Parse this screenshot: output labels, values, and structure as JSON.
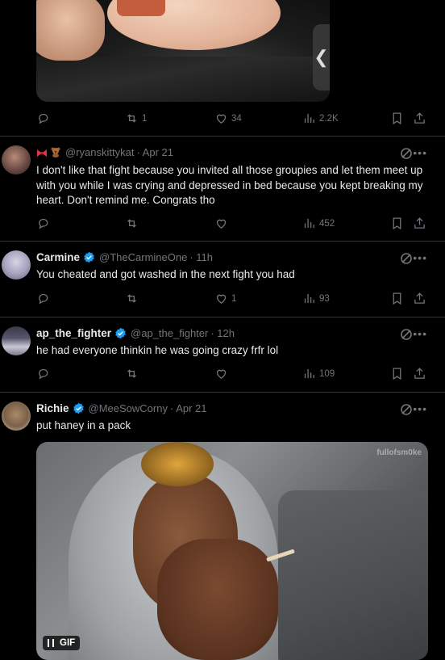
{
  "tweets": [
    {
      "id": "top",
      "actions": {
        "reply": "",
        "retweet": "1",
        "like": "34",
        "views": "2.2K"
      }
    },
    {
      "id": "ryan",
      "name_emoji": [
        "bow",
        "bear"
      ],
      "handle": "@ryanskittykat",
      "time": "· Apr 21",
      "text": "I don't like that fight because you invited all those groupies and let them meet up with you while I was crying and depressed in bed because you kept breaking my heart. Don't remind me. Congrats tho",
      "actions": {
        "reply": "",
        "retweet": "",
        "like": "",
        "views": "452"
      }
    },
    {
      "id": "carmine",
      "name": "Carmine",
      "handle": "@TheCarmineOne",
      "time": "· 11h",
      "text": "You cheated and got washed in the next fight you had",
      "actions": {
        "reply": "",
        "retweet": "",
        "like": "1",
        "views": "93"
      }
    },
    {
      "id": "ap",
      "name": "ap_the_fighter",
      "handle": "@ap_the_fighter",
      "time": "· 12h",
      "text": "he had everyone thinkin he was going crazy frfr lol",
      "actions": {
        "reply": "",
        "retweet": "",
        "like": "",
        "views": "109"
      }
    },
    {
      "id": "richie",
      "name": "Richie",
      "handle": "@MeeSowCorny",
      "time": "· Apr 21",
      "text": "put haney in a pack",
      "media": {
        "badge": "GIF",
        "watermark": "fullofsm0ke"
      }
    }
  ],
  "colors": {
    "background": "#000000",
    "text": "#e7e9ea",
    "muted": "#71767b",
    "verified": "#1d9bf0",
    "divider": "#2f3336"
  },
  "icons": [
    "reply-icon",
    "retweet-icon",
    "like-icon",
    "views-icon",
    "bookmark-icon",
    "share-icon",
    "grok-icon",
    "more-icon",
    "verified-icon",
    "chevron-left-icon"
  ]
}
